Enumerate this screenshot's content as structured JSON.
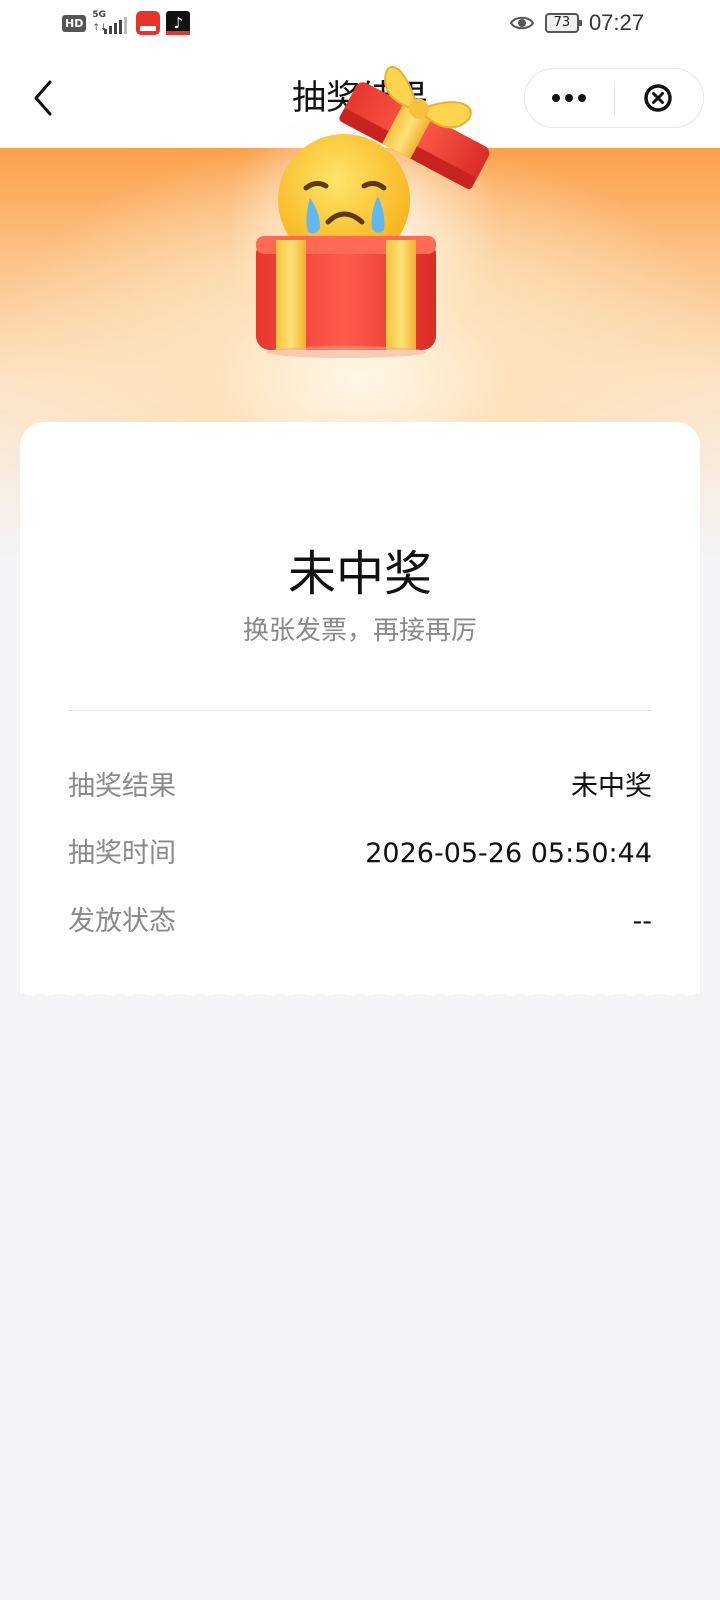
{
  "status_bar": {
    "hd": "HD",
    "network": "5G",
    "network_arrows": "↑↓",
    "battery": "73",
    "time": "07:27",
    "icons": [
      "hd-icon",
      "signal-icon",
      "red-app-icon",
      "douyin-app-icon",
      "eye-icon",
      "battery-icon"
    ]
  },
  "nav": {
    "title": "抽奖结果",
    "icons": [
      "back-arrow-icon",
      "more-dots-icon",
      "close-circle-icon"
    ]
  },
  "hero": {
    "icon": "sad-emoji-gift-box"
  },
  "result": {
    "title": "未中奖",
    "subtitle": "换张发票，再接再厉"
  },
  "details": [
    {
      "label": "抽奖结果",
      "value": "未中奖"
    },
    {
      "label": "抽奖时间",
      "value": "2026-05-26 05:50:44"
    },
    {
      "label": "发放状态",
      "value": "--"
    }
  ],
  "colors": {
    "accent_orange": "#fca04a",
    "page_bg": "#f3f4f8",
    "label_gray": "#8a8a8a"
  }
}
